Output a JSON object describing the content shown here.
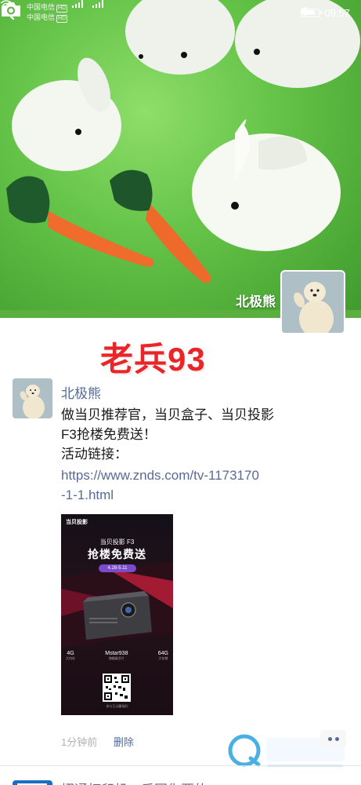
{
  "status_bar": {
    "carrier_1": "中国电信",
    "carrier_2": "中国电信",
    "hd_badge": "HD",
    "network": "4G",
    "time": "09:57"
  },
  "cover": {
    "owner_name": "北极熊"
  },
  "watermark": {
    "text": "老兵93"
  },
  "post": {
    "author": "北极熊",
    "text_lines": [
      "做当贝推荐官，当贝盒子、当贝投影",
      "F3抢楼免费送！",
      "活动链接："
    ],
    "link_lines": [
      "https://www.znds.com/tv-1173170",
      "-1-1.html"
    ],
    "image": {
      "brand": "当贝投影",
      "title": "当贝投影 F3",
      "headline": "抢楼免费送",
      "date": "4.28-5.11",
      "specs": [
        {
          "value": "4G",
          "desc": "大内存"
        },
        {
          "value": "Mstar938",
          "desc": "旗舰级芯片"
        },
        {
          "value": "64G",
          "desc": "大存储"
        }
      ],
      "qr_note": "参与互动赢福利"
    },
    "time": "1分钟前",
    "delete_label": "删除"
  },
  "next_post": {
    "text": "招通打印机、乐园你要的..."
  },
  "icons": {
    "back": "chevron-left-icon",
    "camera": "camera-icon",
    "more": "more-dots-icon"
  },
  "colors": {
    "link": "#576b95",
    "watermark": "#e8262a",
    "cover_green": "#63c247"
  }
}
